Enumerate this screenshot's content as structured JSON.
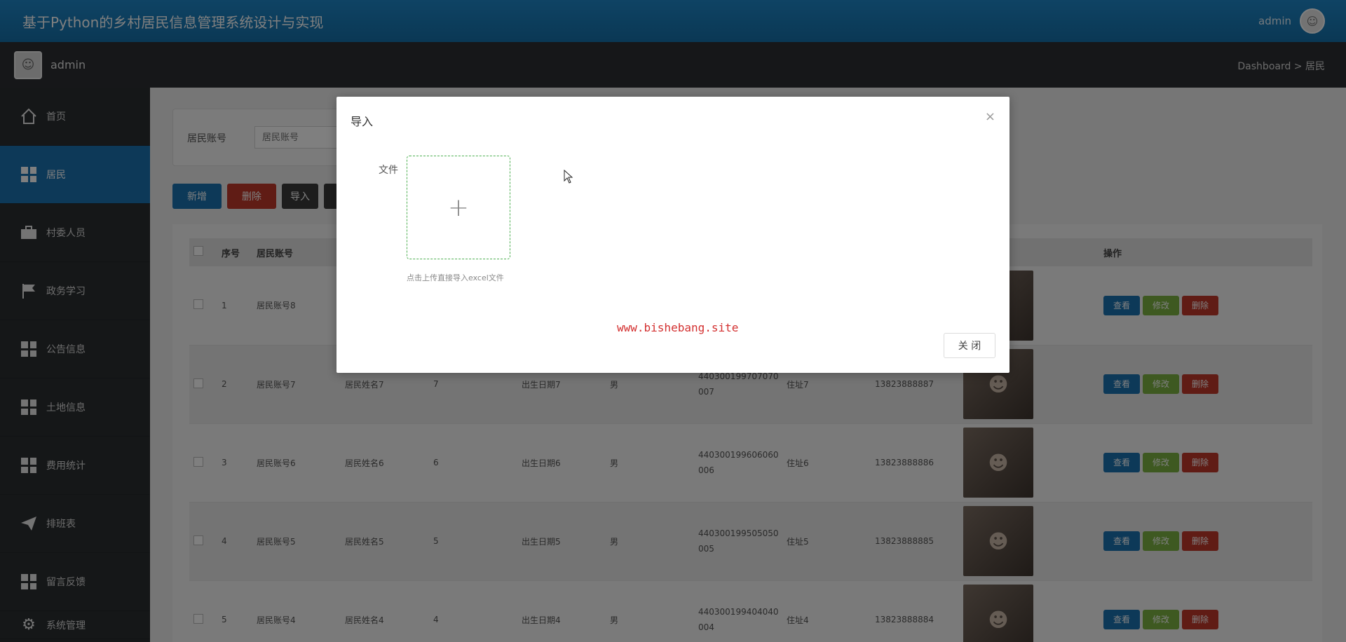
{
  "header": {
    "title": "基于Python的乡村居民信息管理系统设计与实现",
    "username": "admin"
  },
  "subbar": {
    "username": "admin",
    "breadcrumb": "Dashboard > 居民"
  },
  "sidebar": {
    "items": [
      {
        "label": "首页",
        "icon": "home-icon"
      },
      {
        "label": "居民",
        "icon": "grid-icon",
        "active": true
      },
      {
        "label": "村委人员",
        "icon": "briefcase-icon"
      },
      {
        "label": "政务学习",
        "icon": "flag-icon"
      },
      {
        "label": "公告信息",
        "icon": "grid-icon"
      },
      {
        "label": "土地信息",
        "icon": "grid-icon"
      },
      {
        "label": "费用统计",
        "icon": "grid-icon"
      },
      {
        "label": "排班表",
        "icon": "paper-plane-icon"
      },
      {
        "label": "留言反馈",
        "icon": "grid-icon"
      },
      {
        "label": "系统管理",
        "icon": "settings-icon"
      }
    ]
  },
  "search": {
    "label": "居民账号",
    "placeholder": "居民账号"
  },
  "toolbar": {
    "add_label": "新增",
    "delete_label": "删除",
    "import_label": "导入"
  },
  "table": {
    "headers": [
      "序号",
      "居民账号",
      "",
      "",
      "",
      "",
      "",
      "",
      "",
      "",
      "操作"
    ],
    "rows": [
      {
        "no": "1",
        "account": "居民账号8",
        "name": "",
        "age": "",
        "birth": "",
        "gender": "",
        "idcard": "",
        "address": "",
        "phone": ""
      },
      {
        "no": "2",
        "account": "居民账号7",
        "name": "居民姓名7",
        "age": "7",
        "birth": "出生日期7",
        "gender": "男",
        "idcard": "440300199707070007",
        "address": "住址7",
        "phone": "13823888887"
      },
      {
        "no": "3",
        "account": "居民账号6",
        "name": "居民姓名6",
        "age": "6",
        "birth": "出生日期6",
        "gender": "男",
        "idcard": "440300199606060006",
        "address": "住址6",
        "phone": "13823888886"
      },
      {
        "no": "4",
        "account": "居民账号5",
        "name": "居民姓名5",
        "age": "5",
        "birth": "出生日期5",
        "gender": "男",
        "idcard": "440300199505050005",
        "address": "住址5",
        "phone": "13823888885"
      },
      {
        "no": "5",
        "account": "居民账号4",
        "name": "居民姓名4",
        "age": "4",
        "birth": "出生日期4",
        "gender": "男",
        "idcard": "440300199404040004",
        "address": "住址4",
        "phone": "13823888884"
      }
    ],
    "op_view": "查看",
    "op_edit": "修改",
    "op_delete": "删除"
  },
  "modal": {
    "title": "导入",
    "close_icon": "×",
    "file_label": "文件",
    "upload_icon": "+",
    "upload_tip": "点击上传直接导入excel文件",
    "watermark": "www.bishebang.site",
    "close_button": "关 闭"
  }
}
